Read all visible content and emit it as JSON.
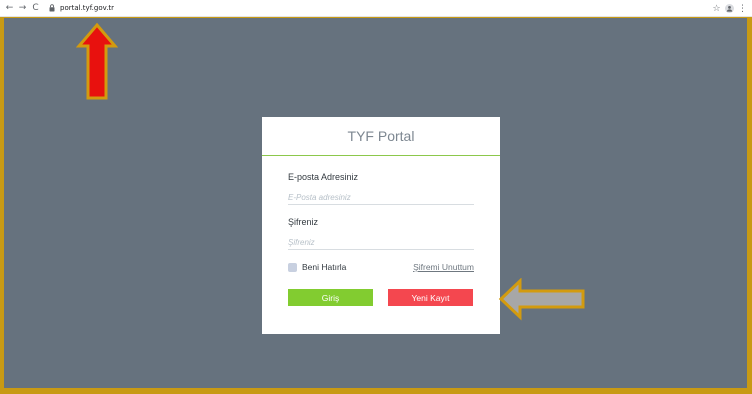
{
  "browser": {
    "back_icon": "←",
    "forward_icon": "→",
    "reload_icon": "C",
    "url": "portal.tyf.gov.tr",
    "star_icon": "☆",
    "menu_icon": "⋮"
  },
  "login": {
    "title": "TYF Portal",
    "email_label": "E-posta Adresiniz",
    "email_placeholder": "E-Posta adresiniz",
    "email_value": "",
    "password_label": "Şifreniz",
    "password_placeholder": "Şifreniz",
    "password_value": "",
    "remember_label": "Beni Hatırla",
    "forgot_label": "Şifremi Unuttum",
    "login_button": "Giriş",
    "register_button": "Yeni Kayıt"
  },
  "colors": {
    "frame": "#c89a14",
    "page_background": "#66727e",
    "accent_green": "#82cc30",
    "accent_red": "#f4474f",
    "arrow_red": "#e8110e",
    "arrow_gray": "#a7a7a7",
    "arrow_outline": "#d39b0f"
  },
  "annotations": [
    "red-up-arrow",
    "gray-left-arrow"
  ]
}
